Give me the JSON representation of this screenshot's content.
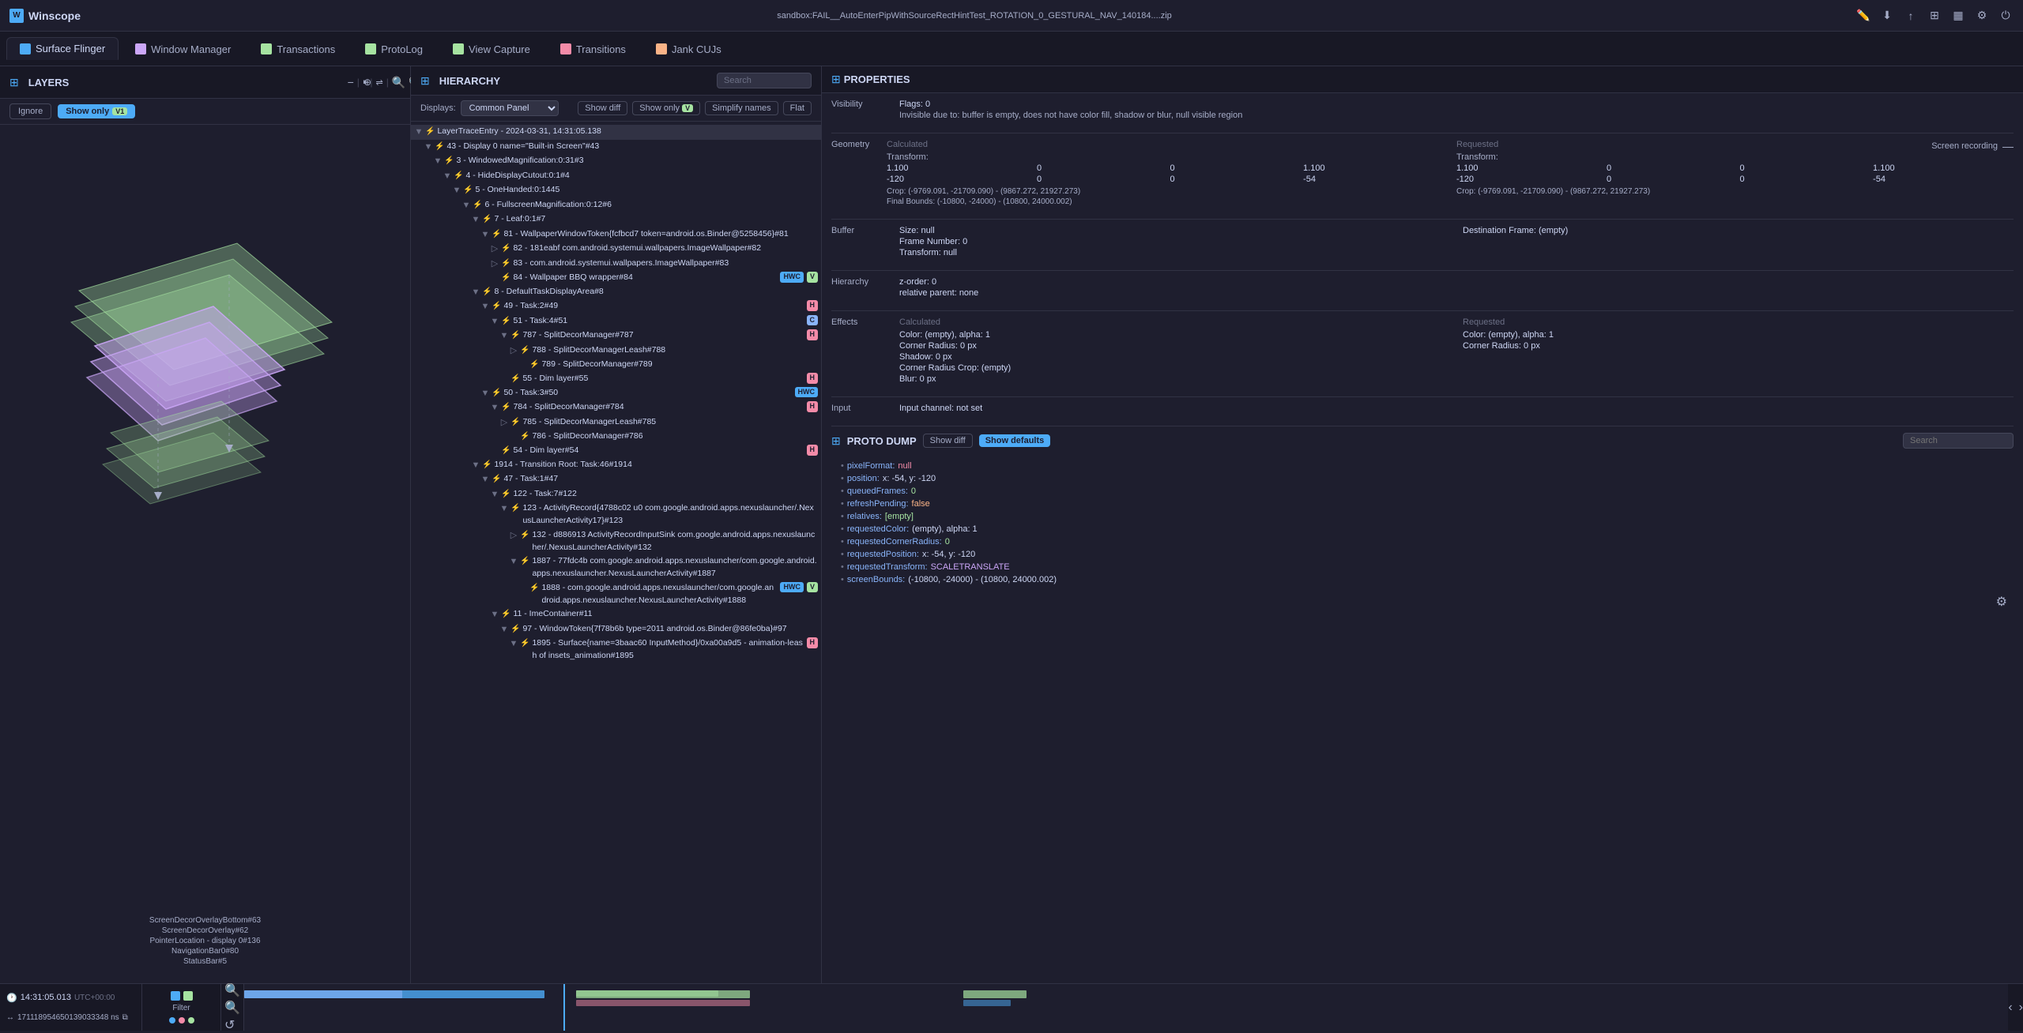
{
  "app": {
    "name": "Winscope",
    "logo": "W",
    "filename": "sandbox:FAIL__AutoEnterPipWithSourceRectHintTest_ROTATION_0_GESTURAL_NAV_140184....zip"
  },
  "tabs": [
    {
      "label": "Surface Flinger",
      "active": true,
      "color": "#4dabf7"
    },
    {
      "label": "Window Manager",
      "active": false,
      "color": "#cba6f7"
    },
    {
      "label": "Transactions",
      "active": false,
      "color": "#a6e3a1"
    },
    {
      "label": "ProtoLog",
      "active": false,
      "color": "#a6e3a1"
    },
    {
      "label": "View Capture",
      "active": false,
      "color": "#a6e3a1"
    },
    {
      "label": "Transitions",
      "active": false,
      "color": "#f38ba8"
    },
    {
      "label": "Jank CUJs",
      "active": false,
      "color": "#fab387"
    }
  ],
  "layers_panel": {
    "title": "LAYERS",
    "ignore_label": "Ignore",
    "show_only_label": "Show only",
    "badge": "V1",
    "labels": [
      "ScreenDecorOverlayBottom#63",
      "ScreenDecorOverlay#62",
      "PointerLocation - display 0#136",
      "NavigationBar0#80",
      "StatusBar#5"
    ]
  },
  "hierarchy_panel": {
    "title": "HIERARCHY",
    "search_placeholder": "Search",
    "show_diff_label": "Show diff",
    "show_only_label": "Show only",
    "badge": "V",
    "simplify_names_label": "Simplify names",
    "flat_label": "Flat",
    "displays_label": "Displays:",
    "displays_value": "Common Panel",
    "tree": [
      {
        "indent": 0,
        "arrow": "▼",
        "text": "LayerTraceEntry - 2024-03-31, 14:31:05.138",
        "depth": 0
      },
      {
        "indent": 1,
        "arrow": "▼",
        "text": "43 - Display 0 name=\"Built-in Screen\"#43",
        "depth": 1
      },
      {
        "indent": 2,
        "arrow": "▼",
        "text": "3 - WindowedMagnification:0:31#3",
        "depth": 2
      },
      {
        "indent": 3,
        "arrow": "▼",
        "text": "4 - HideDisplayCutout:0:1#4",
        "depth": 3
      },
      {
        "indent": 4,
        "arrow": "▼",
        "text": "5 - OneHanded:0:1445",
        "depth": 4
      },
      {
        "indent": 5,
        "arrow": "▼",
        "text": "6 - FullscreenMagnification:0:12#6",
        "depth": 5
      },
      {
        "indent": 6,
        "arrow": "▼",
        "text": "7 - Leaf:0:1#7",
        "depth": 6
      },
      {
        "indent": 7,
        "arrow": "▼",
        "text": "81 - WallpaperWindowToken{fcfbcd7 token=android.os.Binder@5258456}#81",
        "depth": 7
      },
      {
        "indent": 8,
        "arrow": "▷",
        "text": "82 - 181eabf com.android.systemui.wallpapers.ImageWallpaper#82",
        "depth": 8
      },
      {
        "indent": 8,
        "arrow": "▷",
        "text": "83 - com.android.systemui.wallpapers.ImageWallpaper#83",
        "depth": 8
      },
      {
        "indent": 8,
        "arrow": " ",
        "text": "84 - Wallpaper BBQ wrapper#84",
        "depth": 8,
        "badges": [
          "HWC",
          "V"
        ]
      },
      {
        "indent": 6,
        "arrow": "▼",
        "text": "8 - DefaultTaskDisplayArea#8",
        "depth": 6
      },
      {
        "indent": 7,
        "arrow": "▼",
        "text": "49 - Task:2#49",
        "depth": 7,
        "badges": [
          "H"
        ]
      },
      {
        "indent": 8,
        "arrow": "▼",
        "text": "51 - Task:4#51",
        "depth": 8,
        "badges": [
          "C"
        ]
      },
      {
        "indent": 9,
        "arrow": "▼",
        "text": "787 - SplitDecorManager#787",
        "depth": 9,
        "badges": [
          "H"
        ]
      },
      {
        "indent": 10,
        "arrow": "▷",
        "text": "788 - SplitDecorManagerLeash#788",
        "depth": 10
      },
      {
        "indent": 11,
        "arrow": " ",
        "text": "789 - SplitDecorManager#789",
        "depth": 11
      },
      {
        "indent": 9,
        "arrow": " ",
        "text": "55 - Dim layer#55",
        "depth": 9,
        "badges": [
          "H"
        ]
      },
      {
        "indent": 7,
        "arrow": "▼",
        "text": "50 - Task:3#50",
        "depth": 7,
        "badges": [
          "HWC"
        ]
      },
      {
        "indent": 8,
        "arrow": "▼",
        "text": "784 - SplitDecorManager#784",
        "depth": 8,
        "badges": [
          "H"
        ]
      },
      {
        "indent": 9,
        "arrow": "▷",
        "text": "785 - SplitDecorManagerLeash#785",
        "depth": 9
      },
      {
        "indent": 10,
        "arrow": " ",
        "text": "786 - SplitDecorManager#786",
        "depth": 10
      },
      {
        "indent": 8,
        "arrow": " ",
        "text": "54 - Dim layer#54",
        "depth": 8,
        "badges": [
          "H"
        ]
      },
      {
        "indent": 6,
        "arrow": "▼",
        "text": "1914 - Transition Root: Task:46#1914",
        "depth": 6
      },
      {
        "indent": 7,
        "arrow": "▼",
        "text": "47 - Task:1#47",
        "depth": 7
      },
      {
        "indent": 8,
        "arrow": "▼",
        "text": "122 - Task:7#122",
        "depth": 8
      },
      {
        "indent": 9,
        "arrow": "▼",
        "text": "123 - ActivityRecord{4788c02 u0 com.google.android.apps.nexuslauncher/.NexusLauncherActivity17}#123",
        "depth": 9
      },
      {
        "indent": 10,
        "arrow": "▷",
        "text": "132 - d886913 ActivityRecordInputSink com.google.android.apps.nexuslauncher/.NexusLauncherActivity#132",
        "depth": 10
      },
      {
        "indent": 10,
        "arrow": "▼",
        "text": "1887 - 77fdc4b com.google.android.apps.nexuslauncher/com.google.android.apps.nexuslauncher.NexusLauncherActivity#1887",
        "depth": 10
      },
      {
        "indent": 11,
        "arrow": " ",
        "text": "1888 - com.google.android.apps.nexuslauncher/com.google.android.apps.nexuslauncher.NexusLauncherActivity#1888",
        "depth": 11,
        "badges": [
          "HWC",
          "V"
        ]
      },
      {
        "indent": 8,
        "arrow": "▼",
        "text": "11 - ImeContainer#11",
        "depth": 8
      },
      {
        "indent": 9,
        "arrow": "▼",
        "text": "97 - WindowToken{7f78b6b type=2011 android.os.Binder@86fe0ba}#97",
        "depth": 9
      },
      {
        "indent": 10,
        "arrow": "▼",
        "text": "1895 - Surface{name=3baac60 InputMethod}/0xa00a9d5 - animation-leash of insets_animation#1895",
        "depth": 10,
        "badges": [
          "H"
        ]
      }
    ]
  },
  "properties_panel": {
    "title": "PROPERTIES",
    "sections": {
      "visibility": {
        "title": "Visibility",
        "flags": "Flags: 0",
        "invisible_due_to": "Invisible due to: buffer is empty, does not have color fill, shadow or blur, null visible region"
      },
      "geometry": {
        "title": "Geometry",
        "calc_header": "Calculated",
        "req_header": "Requested",
        "transform_label": "Transform:",
        "matrix": {
          "calc": [
            [
              1.1,
              0,
              0,
              1.1
            ],
            [
              -120,
              0,
              0,
              -54
            ]
          ],
          "req": [
            [
              1.1,
              0,
              0,
              1.1
            ],
            [
              -120,
              0,
              0,
              -54
            ]
          ]
        },
        "crop_calc": "Crop: (-9769.091, -21709.090) - (9867.272, 21927.273)",
        "crop_req": "Crop: (-9769.091, -21709.090) - (9867.272, 21927.273)",
        "final_bounds": "Final Bounds: (-10800, -24000) - (10800, 24000.002)"
      },
      "buffer": {
        "title": "Buffer",
        "size": "Size: null",
        "frame_number": "Frame Number: 0",
        "transform": "Transform: null"
      },
      "hierarchy": {
        "title": "Hierarchy",
        "z_order": "z-order: 0",
        "relative_parent": "relative parent: none"
      },
      "effects": {
        "title": "Effects",
        "calc_header": "Calculated",
        "req_header": "Requested",
        "calc": {
          "color": "Color: (empty), alpha: 1",
          "corner_radius": "Corner Radius: 0 px",
          "shadow": "Shadow: 0 px",
          "corner_radius_crop": "Corner Radius Crop: (empty)",
          "blur": "Blur: 0 px"
        },
        "req": {
          "color": "Color: (empty), alpha: 1",
          "corner_radius": "Corner Radius: 0 px"
        }
      },
      "input": {
        "title": "Input",
        "channel": "Input channel: not set"
      }
    }
  },
  "proto_dump": {
    "title": "PROTO DUMP",
    "search_placeholder": "Search",
    "show_diff_label": "Show diff",
    "show_defaults_label": "Show defaults",
    "items": [
      {
        "key": "pixelFormat:",
        "value": "null",
        "type": "null"
      },
      {
        "key": "position:",
        "value": "x: -54, y: -120",
        "type": "normal"
      },
      {
        "key": "queuedFrames:",
        "value": "0",
        "type": "number"
      },
      {
        "key": "refreshPending:",
        "value": "false",
        "type": "false"
      },
      {
        "key": "relatives:",
        "value": "[empty]",
        "type": "empty"
      },
      {
        "key": "requestedColor:",
        "value": "(empty), alpha: 1",
        "type": "normal"
      },
      {
        "key": "requestedCornerRadius:",
        "value": "0",
        "type": "number"
      },
      {
        "key": "requestedPosition:",
        "value": "x: -54, y: -120",
        "type": "normal"
      },
      {
        "key": "requestedTransform:",
        "value": "SCALETRANSLATE",
        "type": "special"
      },
      {
        "key": "screenBounds:",
        "value": "(-10800, -24000) - (10800, 24000.002)",
        "type": "normal"
      }
    ]
  },
  "timeline": {
    "time": "14:31:05.013",
    "utc": "UTC+00:00",
    "ns": "171118954650139033348 ns",
    "filter_label": "Filter"
  },
  "screen_recording_label": "Screen recording"
}
